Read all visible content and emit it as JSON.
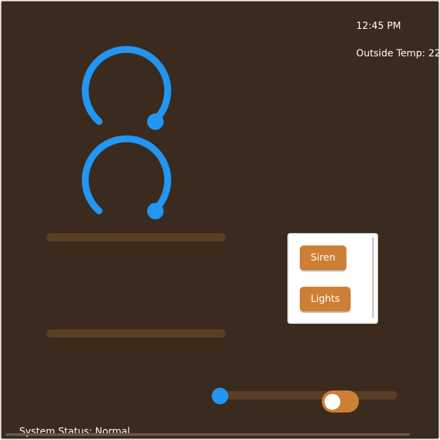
{
  "header": {
    "clock": "12:45 PM",
    "outside_temp": "Outside Temp: 22"
  },
  "knobs": [
    {
      "icon": "dial-knob-icon",
      "accent": "#2196f3"
    },
    {
      "icon": "dial-knob-icon",
      "accent": "#2196f3"
    }
  ],
  "controls": {
    "siren_label": "Siren",
    "lights_label": "Lights",
    "slider_value": 0,
    "toggle_on": false
  },
  "footer": {
    "status": "System Status: Normal"
  },
  "colors": {
    "background": "#3b2a1e",
    "accent": "#2196f3",
    "button": "#cf7f35",
    "track": "#5a3e26"
  }
}
